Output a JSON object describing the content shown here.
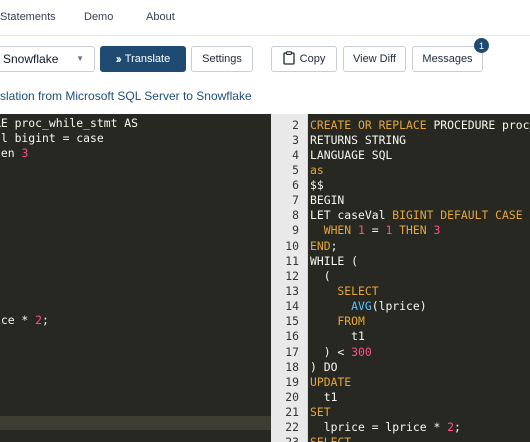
{
  "nav": {
    "items": [
      {
        "label": "Statements"
      },
      {
        "label": "Demo"
      },
      {
        "label": "About"
      }
    ]
  },
  "toolbar": {
    "dialect_select": {
      "value": "Snowflake"
    },
    "translate_label": "Translate",
    "settings_label": "Settings",
    "copy_label": "Copy",
    "view_diff_label": "View Diff",
    "messages_label": "Messages",
    "messages_count": "1"
  },
  "subtitle": "slation from Microsoft SQL Server to Snowflake",
  "colors": {
    "primary": "#1f4a72",
    "editor_bg": "#272822",
    "keyword": "#e6a63a",
    "number": "#ff4f8a",
    "function": "#58c2ff",
    "link_text": "#1e4f7a"
  },
  "left_editor": {
    "lines": [
      [
        {
          "t": "RE proc_while_stmt AS",
          "c": ""
        }
      ],
      [
        {
          "t": "al bigint = case",
          "c": ""
        }
      ],
      [
        {
          "t": "hen ",
          "c": ""
        },
        {
          "t": "3",
          "c": "num"
        }
      ],
      [],
      [],
      [
        {
          "t": ")",
          "c": ""
        }
      ],
      [],
      [],
      [],
      [],
      [],
      [],
      [],
      [
        {
          "t": "ice * ",
          "c": ""
        },
        {
          "t": "2",
          "c": "num"
        },
        {
          "t": ";",
          "c": ""
        }
      ],
      [],
      [],
      [],
      [],
      [],
      [],
      [],
      []
    ]
  },
  "right_editor": {
    "line_numbers": [
      "2",
      "3",
      "4",
      "5",
      "6",
      "7",
      "8",
      "9",
      "10",
      "11",
      "12",
      "13",
      "14",
      "15",
      "16",
      "17",
      "18",
      "19",
      "20",
      "21",
      "22",
      "23"
    ],
    "lines": [
      [
        {
          "t": "CREATE OR REPLACE",
          "c": "kw"
        },
        {
          "t": " PROCEDURE proc_",
          "c": ""
        }
      ],
      [
        {
          "t": "RETURNS STRING",
          "c": ""
        }
      ],
      [
        {
          "t": "LANGUAGE SQL",
          "c": ""
        }
      ],
      [
        {
          "t": "as",
          "c": "kw"
        }
      ],
      [
        {
          "t": "$$",
          "c": ""
        }
      ],
      [
        {
          "t": "BEGIN",
          "c": ""
        }
      ],
      [
        {
          "t": "LET caseVal ",
          "c": ""
        },
        {
          "t": "BIGINT DEFAULT CASE",
          "c": "kw"
        }
      ],
      [
        {
          "t": "  WHEN ",
          "c": "kw"
        },
        {
          "t": "1",
          "c": "num"
        },
        {
          "t": " = ",
          "c": ""
        },
        {
          "t": "1",
          "c": "num"
        },
        {
          "t": " THEN ",
          "c": "kw"
        },
        {
          "t": "3",
          "c": "num"
        }
      ],
      [
        {
          "t": "END",
          "c": "kw"
        },
        {
          "t": ";",
          "c": ""
        }
      ],
      [
        {
          "t": "WHILE (",
          "c": ""
        }
      ],
      [
        {
          "t": "  (",
          "c": ""
        }
      ],
      [
        {
          "t": "    SELECT",
          "c": "kw"
        }
      ],
      [
        {
          "t": "      ",
          "c": ""
        },
        {
          "t": "AVG",
          "c": "fn"
        },
        {
          "t": "(lprice)",
          "c": ""
        }
      ],
      [
        {
          "t": "    FROM",
          "c": "kw"
        }
      ],
      [
        {
          "t": "      t1",
          "c": ""
        }
      ],
      [
        {
          "t": "  ) < ",
          "c": ""
        },
        {
          "t": "300",
          "c": "num"
        }
      ],
      [
        {
          "t": ") DO",
          "c": ""
        }
      ],
      [
        {
          "t": "UPDATE",
          "c": "kw"
        }
      ],
      [
        {
          "t": "  t1",
          "c": ""
        }
      ],
      [
        {
          "t": "SET",
          "c": "kw"
        }
      ],
      [
        {
          "t": "  lprice = lprice * ",
          "c": ""
        },
        {
          "t": "2",
          "c": "num"
        },
        {
          "t": ";",
          "c": ""
        }
      ],
      [
        {
          "t": "SELECT",
          "c": "kw"
        }
      ]
    ]
  }
}
